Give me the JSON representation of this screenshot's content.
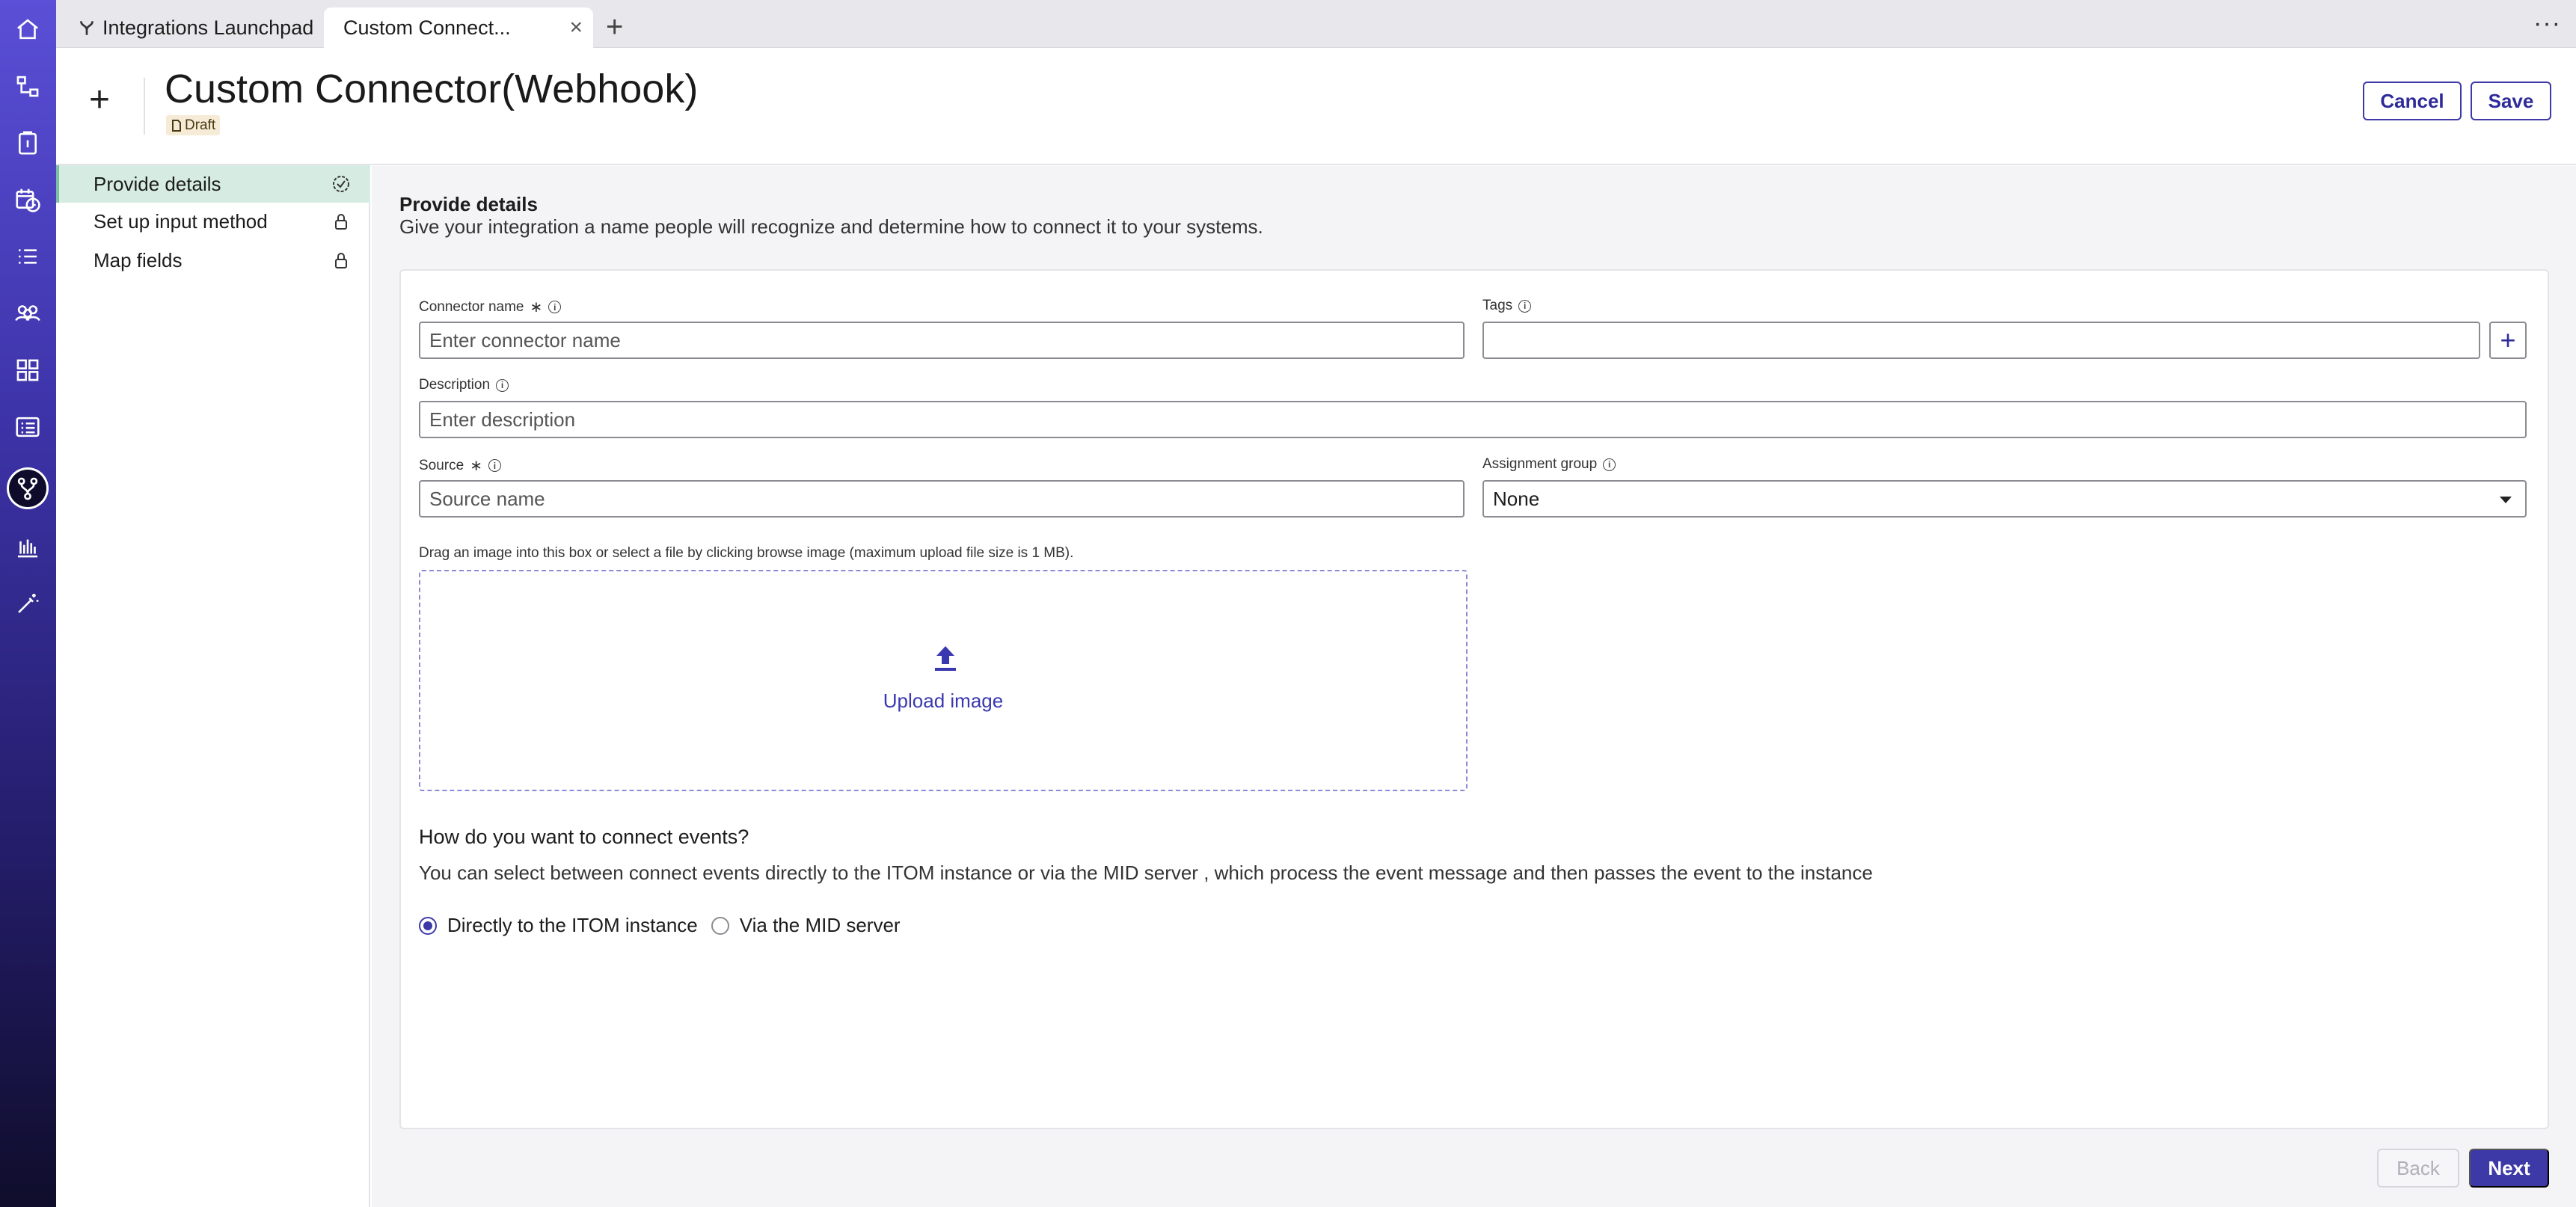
{
  "tabs": {
    "items": [
      {
        "label": "Integrations Launchpad"
      },
      {
        "label": "Custom Connect..."
      }
    ],
    "close_glyph": "×",
    "add_glyph": "+",
    "more_glyph": "···"
  },
  "header": {
    "title": "Custom Connector(Webhook)",
    "badge": "Draft",
    "cancel_label": "Cancel",
    "save_label": "Save"
  },
  "steps": [
    {
      "label": "Provide details",
      "state": "complete"
    },
    {
      "label": "Set up input method",
      "state": "locked"
    },
    {
      "label": "Map fields",
      "state": "locked"
    }
  ],
  "section": {
    "title": "Provide details",
    "subtitle": "Give your integration a name people will recognize and determine how to connect it to your systems."
  },
  "form": {
    "connector_name": {
      "label": "Connector name",
      "placeholder": "Enter connector name",
      "value": ""
    },
    "tags": {
      "label": "Tags",
      "value": ""
    },
    "description": {
      "label": "Description",
      "placeholder": "Enter description",
      "value": ""
    },
    "source": {
      "label": "Source",
      "placeholder": "Source name",
      "value": ""
    },
    "assignment_group": {
      "label": "Assignment group",
      "selected": "None"
    },
    "required_mark": "∗",
    "info_mark": "i"
  },
  "upload": {
    "hint": "Drag an image into this box or select a file by clicking browse image (maximum upload file size is 1 MB).",
    "label": "Upload image"
  },
  "connect": {
    "question": "How do you want to connect events?",
    "explanation": "You can select between connect events directly to the ITOM instance or via the MID server , which process the event message and then passes the event to the instance",
    "options": [
      {
        "label": "Directly to the ITOM instance",
        "selected": true
      },
      {
        "label": "Via the MID server",
        "selected": false
      }
    ]
  },
  "footer": {
    "back_label": "Back",
    "next_label": "Next"
  },
  "colors": {
    "accent": "#3d3aa8",
    "step_active_bg": "#d6ece2",
    "draft_badge_bg": "#f5ebd6"
  },
  "rail_icons": [
    "home-icon",
    "workflow-icon",
    "clipboard-icon",
    "calendar-clock-icon",
    "list-icon",
    "team-icon",
    "grid-icon",
    "table-list-icon",
    "integrations-icon",
    "reports-icon",
    "magic-wand-icon"
  ]
}
